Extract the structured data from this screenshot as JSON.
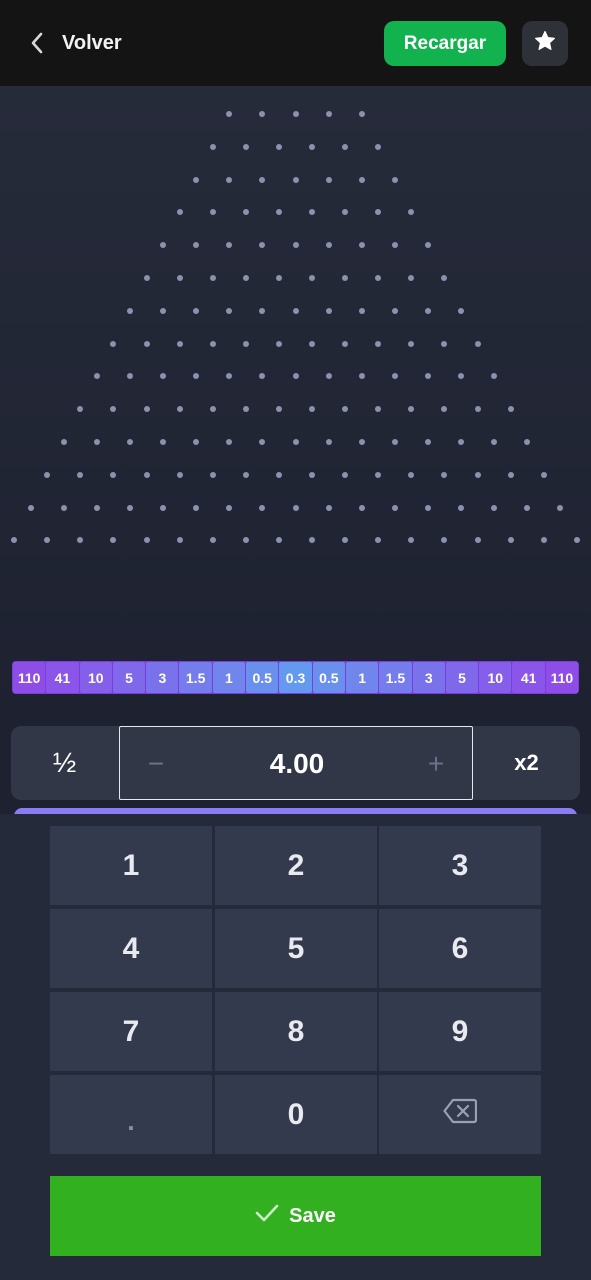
{
  "header": {
    "back_label": "Volver",
    "recharge_label": "Recargar",
    "favorite_icon": "star-icon"
  },
  "board": {
    "peg_rows": [
      5,
      6,
      7,
      8,
      9,
      10,
      11,
      12,
      13,
      14,
      15,
      16,
      17,
      18
    ],
    "multipliers": [
      "110",
      "41",
      "10",
      "5",
      "3",
      "1.5",
      "1",
      "0.5",
      "0.3",
      "0.5",
      "1",
      "1.5",
      "3",
      "5",
      "10",
      "41",
      "110"
    ],
    "multiplier_colors": [
      "#8e4de6",
      "#8a55e8",
      "#855ee9",
      "#7f68ea",
      "#7a72eb",
      "#757cec",
      "#7086ec",
      "#6a90ed",
      "#6399ee",
      "#6a90ed",
      "#7086ec",
      "#757cec",
      "#7a72eb",
      "#7f68ea",
      "#855ee9",
      "#8a55e8",
      "#8e4de6"
    ]
  },
  "bet": {
    "half_label": "½",
    "minus_label": "−",
    "amount": "4.00",
    "plus_label": "+",
    "double_label": "x2"
  },
  "keypad": {
    "keys": [
      "1",
      "2",
      "3",
      "4",
      "5",
      "6",
      "7",
      "8",
      "9",
      ".",
      "0",
      "backspace"
    ],
    "save_label": "Save"
  },
  "colors": {
    "accent_green": "#12b24f",
    "save_green": "#33b020",
    "background": "#1d2130"
  }
}
